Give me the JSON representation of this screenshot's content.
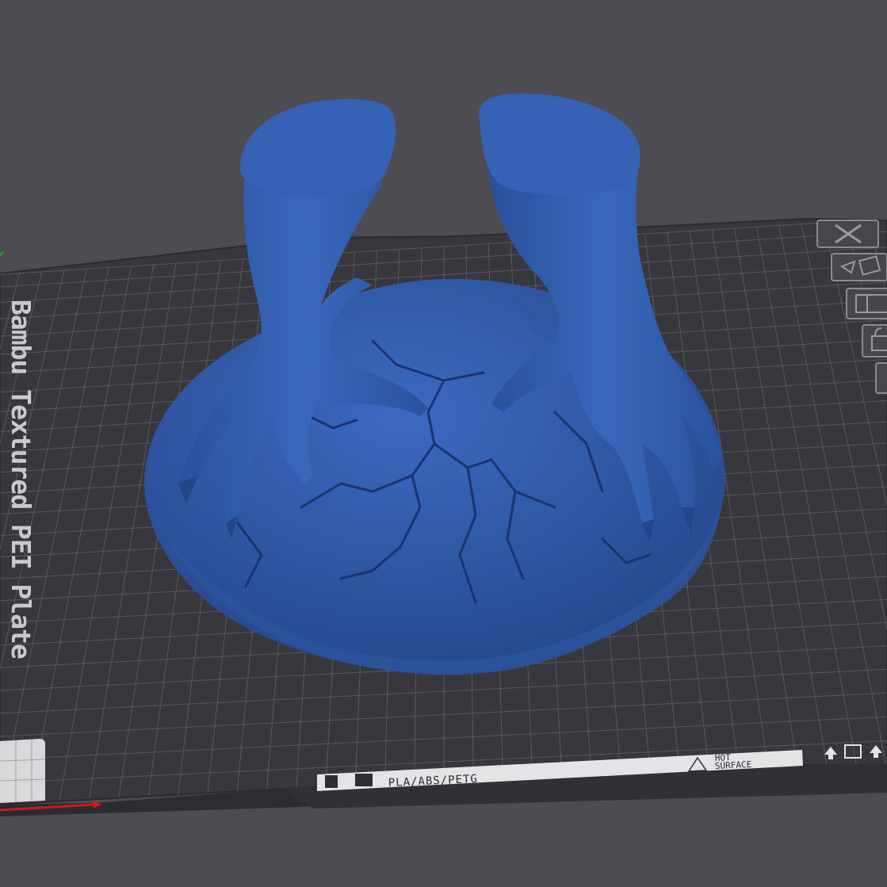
{
  "viewport": {
    "background": "#4d4c53"
  },
  "plate": {
    "name": "Bambu Textured PEI Plate",
    "material_label": "PLA/ABS/PETG",
    "warning_label_line1": "HOT",
    "warning_label_line2": "SURFACE",
    "surface_color": "#38373d",
    "grid_color": "#5a5960"
  },
  "model": {
    "name": "dragon-claws-egg",
    "color": "#3460b0"
  },
  "plate_toolbar": {
    "items": [
      {
        "name": "close-icon"
      },
      {
        "name": "auto-orient-icon"
      },
      {
        "name": "arrange-icon"
      },
      {
        "name": "lock-icon"
      },
      {
        "name": "settings-icon"
      }
    ]
  },
  "axes": {
    "x_color": "#d01818",
    "y_color": "#1cb01c"
  }
}
